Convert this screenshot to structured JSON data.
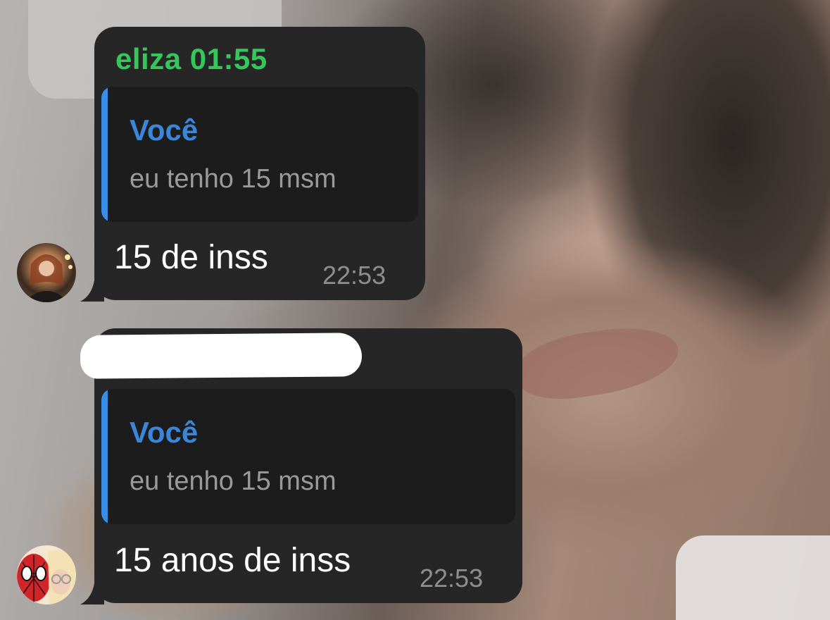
{
  "messages": [
    {
      "sender": "eliza 01:55",
      "sender_color": "#35c759",
      "avatar_icon": "user-avatar-icon",
      "reply": {
        "author": "Você",
        "text": "eu tenho 15 msm"
      },
      "text": "15 de inss",
      "time": "22:53"
    },
    {
      "sender_redacted": true,
      "avatar_icon": "spiderman-avatar-icon",
      "reply": {
        "author": "Você",
        "text": "eu tenho 15 msm"
      },
      "text": "15 anos de inss",
      "time": "22:53"
    }
  ],
  "colors": {
    "bubble": "#262626",
    "quote_background": "#1c1c1c",
    "quote_bar": "#3a8ee6",
    "quote_author": "#3a86d9",
    "timestamp": "#8e8e8e"
  }
}
